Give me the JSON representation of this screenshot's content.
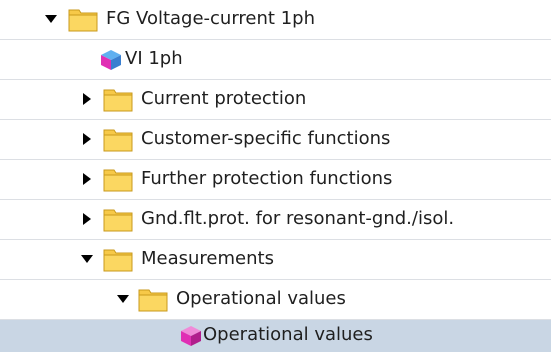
{
  "project_tree": {
    "items": [
      {
        "label": "FG Voltage-current 1ph",
        "icon": "folder-icon",
        "state": "expanded"
      },
      {
        "label": "VI 1ph",
        "icon": "function-block-cube-icon"
      },
      {
        "label": "Current protection",
        "icon": "folder-icon",
        "state": "collapsed"
      },
      {
        "label": "Customer-specific functions",
        "icon": "folder-icon",
        "state": "collapsed"
      },
      {
        "label": "Further protection functions",
        "icon": "folder-icon",
        "state": "collapsed"
      },
      {
        "label": "Gnd.flt.prot. for resonant-gnd./isol.",
        "icon": "folder-icon",
        "state": "collapsed"
      },
      {
        "label": "Measurements",
        "icon": "folder-icon",
        "state": "expanded"
      },
      {
        "label": "Operational values",
        "icon": "folder-icon",
        "state": "expanded"
      },
      {
        "label": "Operational values",
        "icon": "function-cube-icon",
        "selected": true
      }
    ]
  },
  "colors": {
    "folder": "#f7c948",
    "selection": "#c9d6e4",
    "separator": "#dcdfe4",
    "cube_magenta": "#e02fb4",
    "cube_blue": "#3a8fe0"
  }
}
